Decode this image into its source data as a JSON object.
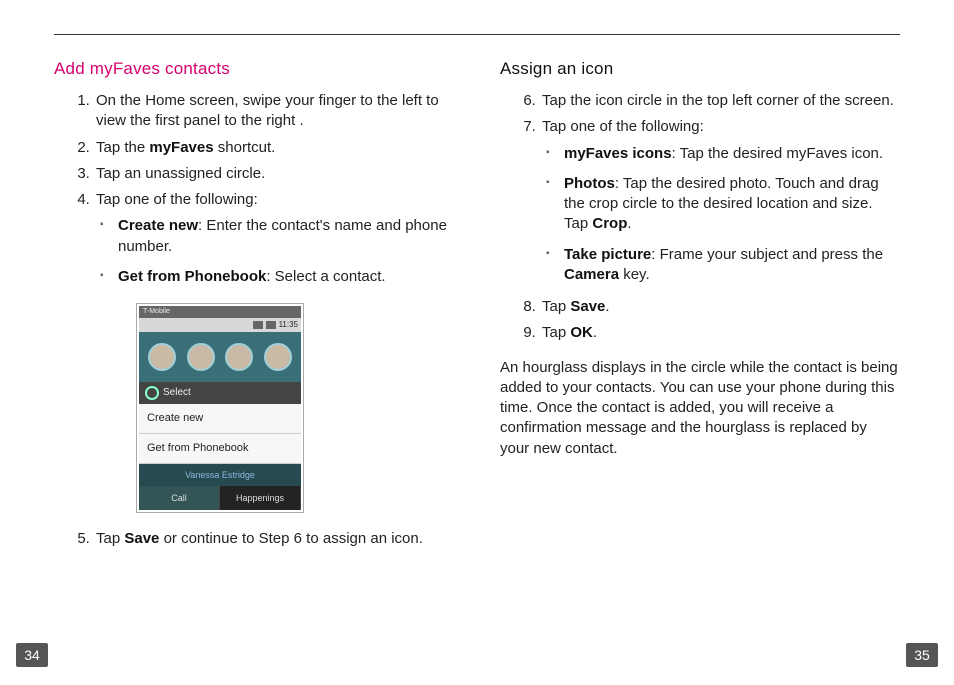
{
  "left": {
    "heading": "Add myFaves contacts",
    "steps": {
      "s1": "On the Home screen, swipe your finger to the left to view the first panel to the right .",
      "s2_a": "Tap the ",
      "s2_b": "myFaves",
      "s2_c": " shortcut.",
      "s3": "Tap an unassigned circle.",
      "s4": "Tap one of the following:",
      "s4_sub1_b": "Create new",
      "s4_sub1_t": ": Enter the contact's name and phone number.",
      "s4_sub2_b": "Get from Phonebook",
      "s4_sub2_t": ": Select a contact.",
      "s5_a": "Tap ",
      "s5_b": "Save",
      "s5_c": " or continue to Step 6 to assign an icon."
    }
  },
  "right": {
    "heading": "Assign an icon",
    "steps": {
      "s6": "Tap the icon circle in the top left corner of the screen.",
      "s7": "Tap one of the following:",
      "s7_sub1_b": "myFaves icons",
      "s7_sub1_t": ": Tap the desired myFaves icon.",
      "s7_sub2_b": "Photos",
      "s7_sub2_t1": ": Tap the desired photo. Touch and drag the crop circle to the desired location and size. Tap ",
      "s7_sub2_b2": "Crop",
      "s7_sub2_t2": ".",
      "s7_sub3_b": "Take picture",
      "s7_sub3_t1": ": Frame your subject and press the ",
      "s7_sub3_b2": "Camera",
      "s7_sub3_t2": " key.",
      "s8_a": "Tap ",
      "s8_b": "Save",
      "s8_c": ".",
      "s9_a": "Tap ",
      "s9_b": "OK",
      "s9_c": "."
    },
    "note": "An hourglass displays in the circle while the contact is being added to your contacts. You can use your phone during this time. Once the contact is added, you will receive a confirmation message and the hourglass is replaced by your new contact."
  },
  "phone": {
    "time": "11:35",
    "carrier": "T-Mobile",
    "popup_title": "Select",
    "opt1": "Create new",
    "opt2": "Get from Phonebook",
    "name": "Vanessa Estridge",
    "tab1": "Call",
    "tab2": "Happenings"
  },
  "pages": {
    "left": "34",
    "right": "35"
  }
}
